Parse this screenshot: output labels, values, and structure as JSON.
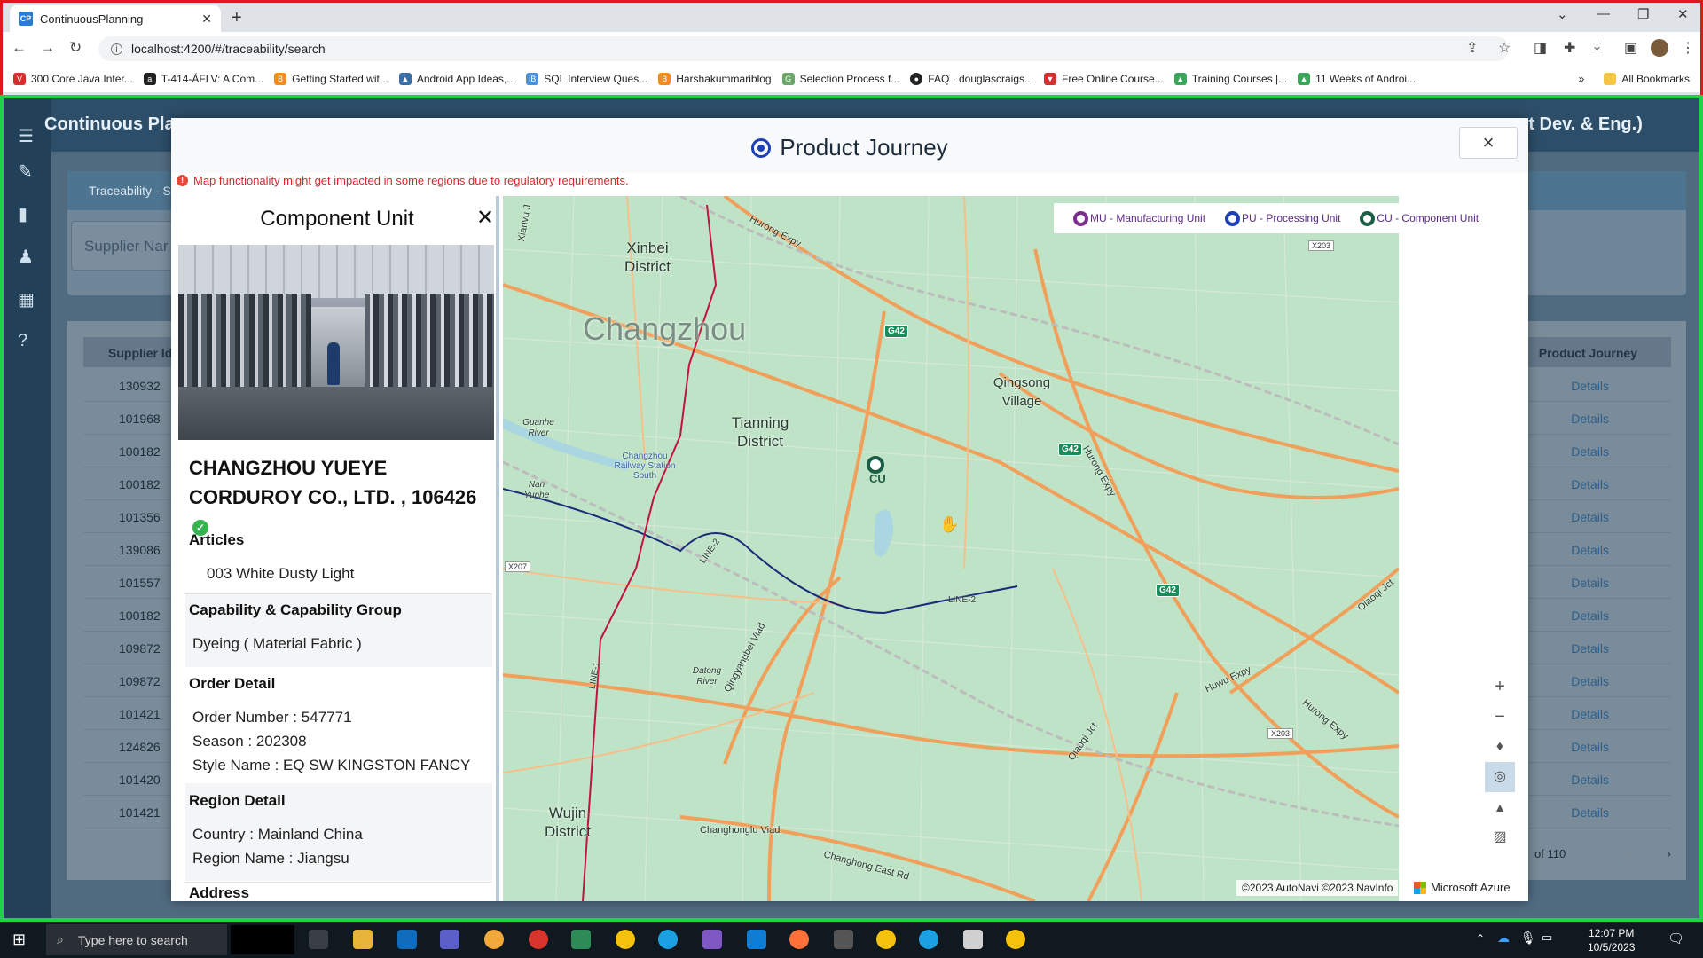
{
  "browser": {
    "tab_title": "ContinuousPlanning",
    "tab_favicon": "CP",
    "url": "localhost:4200/#/traceability/search",
    "bookmarks": [
      "300 Core Java Inter...",
      "T-414-ÁFLV: A Com...",
      "Getting Started wit...",
      "Android App Ideas,...",
      "SQL Interview Ques...",
      "Harshakummariblog",
      "Selection Process f...",
      "FAQ · douglascraigs...",
      "Free Online Course...",
      "Training Courses |...",
      "11 Weeks of Androi..."
    ],
    "all_bookmarks": "All Bookmarks"
  },
  "app": {
    "title": "Continuous Pla",
    "header_right": "uct Dev. & Eng.)",
    "panel_band": "Traceability - S",
    "supplier_placeholder": "Supplier Nar",
    "table": {
      "col_left": "Supplier Id",
      "col_right": "Product Journey",
      "rows": [
        "130932",
        "101968",
        "100182",
        "100182",
        "101356",
        "139086",
        "101557",
        "100182",
        "109872",
        "109872",
        "101421",
        "124826",
        "101420",
        "101421"
      ],
      "link_label": "Details"
    },
    "pager": "of 110"
  },
  "modal": {
    "title": "Product Journey",
    "close": "×",
    "warning": "Map functionality might get impacted in some regions due to regulatory requirements.",
    "panel": {
      "title": "Component Unit",
      "close": "✕",
      "company_line1": "CHANGZHOU YUEYE",
      "company_line2": "CORDUROY CO., LTD. ,  106426",
      "sections": {
        "articles_h": "Articles",
        "article": "003 White Dusty Light",
        "capability_h": "Capability & Capability Group",
        "capability": "Dyeing ( Material Fabric )",
        "order_h": "Order Detail",
        "order_number": "Order Number : 547771",
        "season": "Season : 202308",
        "style": "Style Name : EQ SW KINGSTON FANCY",
        "region_h": "Region Detail",
        "country": "Country : Mainland China",
        "region": "Region Name : Jiangsu",
        "address_h": "Address"
      }
    },
    "legend": [
      {
        "label": "MU - Manufacturing Unit",
        "color": "#7b2e8e"
      },
      {
        "label": "PU - Processing Unit",
        "color": "#1d3fb8"
      },
      {
        "label": "CU - Component Unit",
        "color": "#1b5e45"
      }
    ],
    "map": {
      "city": "Changzhou",
      "labels": {
        "xinbei": "Xinbei District",
        "tianning": "Tianning District",
        "qingsong": "Qingsong Village",
        "wujin": "Wujin District",
        "guanhe": "Guanhe River",
        "station": "Changzhou Railway Station South",
        "nanyunhe": "Nan Yunhe",
        "datong": "Datong River",
        "hurong1": "Hurong Expy",
        "hurong2": "Hurong Expy",
        "hurong3": "Hurong Expy",
        "huwu": "Huwu Expy",
        "qiaoqi": "Qiaoqi Jct",
        "qiaoqi2": "Qiaoqi Jct",
        "line2a": "LINE-2",
        "line2b": "LINE-2",
        "line1": "LINE-1",
        "qingyang": "Qingyangbei Viad",
        "changhong": "Changhong East Rd",
        "changhonglu": "Changhonglu Viad",
        "xianvu": "Xianvu J"
      },
      "shields": [
        "G42",
        "G42",
        "G42"
      ],
      "xroads": [
        "X203",
        "X207",
        "X203"
      ],
      "marker_label": "CU",
      "attribution": "©2023 AutoNavi ©2023 NavInfo",
      "brand": "Microsoft Azure"
    }
  },
  "taskbar": {
    "search_placeholder": "Type here to search",
    "time": "12:07 PM",
    "date": "10/5/2023"
  }
}
